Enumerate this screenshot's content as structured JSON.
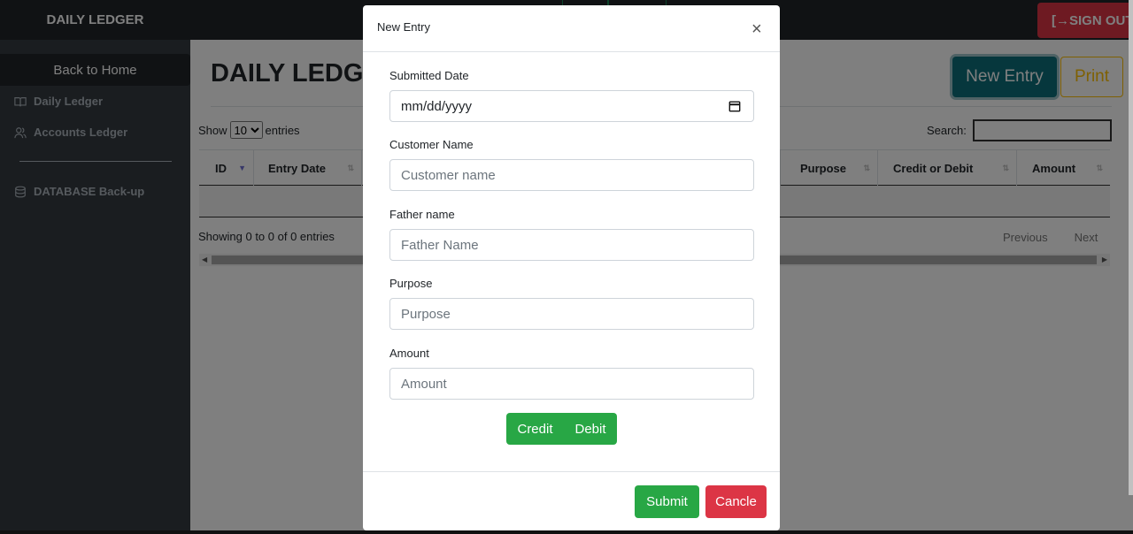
{
  "app": {
    "brand": "DAILY LEDGER",
    "sign_out": "[→SIGN OUT"
  },
  "sidebar": {
    "back_home": "Back to Home",
    "items": [
      {
        "label": "Daily Ledger",
        "icon": "book-icon"
      },
      {
        "label": "Accounts Ledger",
        "icon": "users-icon"
      },
      {
        "label": "DATABASE Back-up",
        "icon": "database-icon"
      }
    ]
  },
  "main": {
    "title": "DAILY LEDGER",
    "new_entry": "New Entry",
    "print": "Print",
    "show_prefix": "Show",
    "show_value": "10",
    "show_suffix": "entries",
    "search_label": "Search:",
    "columns": [
      "ID",
      "Entry Date",
      "Purpose",
      "Credit or Debit",
      "Amount"
    ],
    "showing": "Showing 0 to 0 of 0 entries",
    "previous": "Previous",
    "next": "Next"
  },
  "modal": {
    "title": "New Entry",
    "close": "×",
    "fields": [
      {
        "label": "Submitted Date",
        "placeholder": "mm/dd/yyyy"
      },
      {
        "label": "Customer Name",
        "placeholder": "Customer name"
      },
      {
        "label": "Father name",
        "placeholder": "Father Name"
      },
      {
        "label": "Purpose",
        "placeholder": "Purpose"
      },
      {
        "label": "Amount",
        "placeholder": "Amount"
      }
    ],
    "credit": "Credit",
    "debit": "Debit",
    "submit": "Submit",
    "cancel": "Cancle"
  },
  "colors": {
    "dark": "#212529",
    "sidebar": "#343a40",
    "success": "#28a745",
    "danger": "#dc3545",
    "teal": "#0d6e7b",
    "warning": "#ffc107"
  }
}
